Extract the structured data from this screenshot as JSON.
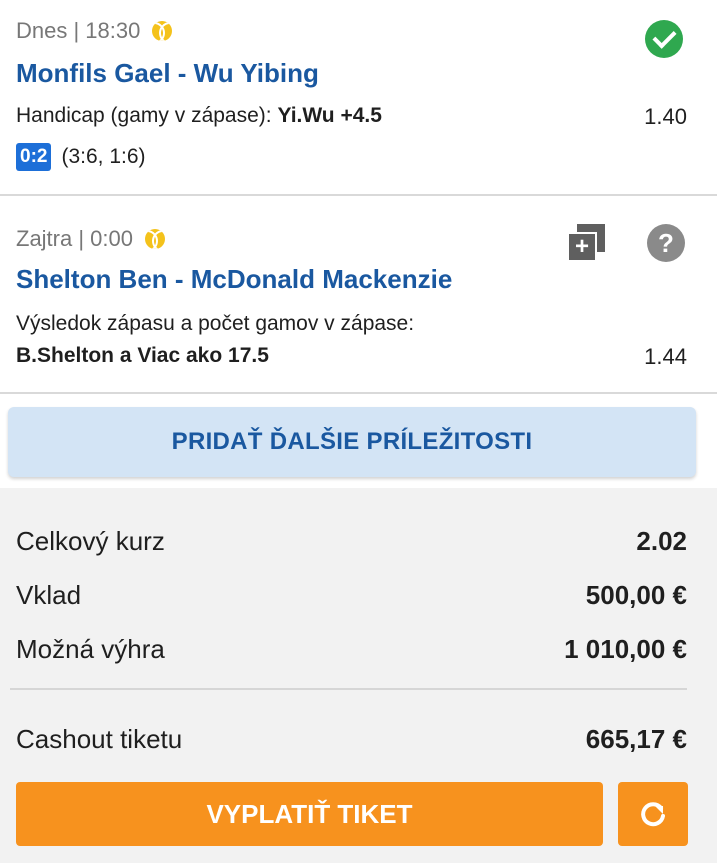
{
  "bets": [
    {
      "date": "Dnes | 18:30",
      "sport_icon": "tennis-ball-icon",
      "match": "Monfils Gael - Wu Yibing",
      "market_label": "Handicap (gamy v zápase):",
      "selection": "Yi.Wu +4.5",
      "odds": "1.40",
      "score": "0:2",
      "set_scores": "(3:6, 1:6)",
      "status_icon": "check-circle-icon"
    },
    {
      "date": "Zajtra | 0:00",
      "sport_icon": "tennis-ball-icon",
      "match": "Shelton Ben - McDonald Mackenzie",
      "market_label": "Výsledok zápasu a počet gamov v zápase:",
      "selection": "B.Shelton a Viac ako 17.5",
      "odds": "1.44",
      "icons": [
        "copy-add-icon",
        "help-icon"
      ],
      "help_glyph": "?"
    }
  ],
  "add_button_label": "PRIDAŤ ĎALŠIE PRÍLEŽITOSTI",
  "summary": {
    "total_odds_label": "Celkový kurz",
    "total_odds_value": "2.02",
    "stake_label": "Vklad",
    "stake_value": "500,00 €",
    "potential_win_label": "Možná výhra",
    "potential_win_value": "1 010,00 €",
    "cashout_label": "Cashout tiketu",
    "cashout_value": "665,17 €"
  },
  "payout_button_label": "VYPLATIŤ TIKET",
  "colors": {
    "brand_blue": "#1a58a0",
    "accent_orange": "#f7921e",
    "success_green": "#2fa84f",
    "score_blue": "#1d6fd8",
    "add_button_bg": "#d3e4f5"
  }
}
